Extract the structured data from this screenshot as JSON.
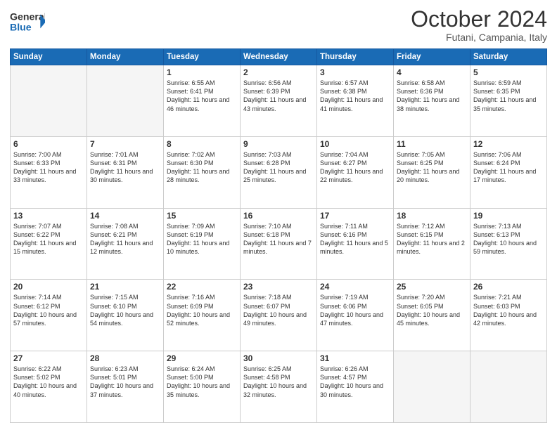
{
  "header": {
    "logo_line1": "General",
    "logo_line2": "Blue",
    "month": "October 2024",
    "location": "Futani, Campania, Italy"
  },
  "days_of_week": [
    "Sunday",
    "Monday",
    "Tuesday",
    "Wednesday",
    "Thursday",
    "Friday",
    "Saturday"
  ],
  "weeks": [
    [
      {
        "day": "",
        "sunrise": "",
        "sunset": "",
        "daylight": "",
        "empty": true
      },
      {
        "day": "",
        "sunrise": "",
        "sunset": "",
        "daylight": "",
        "empty": true
      },
      {
        "day": "1",
        "sunrise": "Sunrise: 6:55 AM",
        "sunset": "Sunset: 6:41 PM",
        "daylight": "Daylight: 11 hours and 46 minutes.",
        "empty": false
      },
      {
        "day": "2",
        "sunrise": "Sunrise: 6:56 AM",
        "sunset": "Sunset: 6:39 PM",
        "daylight": "Daylight: 11 hours and 43 minutes.",
        "empty": false
      },
      {
        "day": "3",
        "sunrise": "Sunrise: 6:57 AM",
        "sunset": "Sunset: 6:38 PM",
        "daylight": "Daylight: 11 hours and 41 minutes.",
        "empty": false
      },
      {
        "day": "4",
        "sunrise": "Sunrise: 6:58 AM",
        "sunset": "Sunset: 6:36 PM",
        "daylight": "Daylight: 11 hours and 38 minutes.",
        "empty": false
      },
      {
        "day": "5",
        "sunrise": "Sunrise: 6:59 AM",
        "sunset": "Sunset: 6:35 PM",
        "daylight": "Daylight: 11 hours and 35 minutes.",
        "empty": false
      }
    ],
    [
      {
        "day": "6",
        "sunrise": "Sunrise: 7:00 AM",
        "sunset": "Sunset: 6:33 PM",
        "daylight": "Daylight: 11 hours and 33 minutes.",
        "empty": false
      },
      {
        "day": "7",
        "sunrise": "Sunrise: 7:01 AM",
        "sunset": "Sunset: 6:31 PM",
        "daylight": "Daylight: 11 hours and 30 minutes.",
        "empty": false
      },
      {
        "day": "8",
        "sunrise": "Sunrise: 7:02 AM",
        "sunset": "Sunset: 6:30 PM",
        "daylight": "Daylight: 11 hours and 28 minutes.",
        "empty": false
      },
      {
        "day": "9",
        "sunrise": "Sunrise: 7:03 AM",
        "sunset": "Sunset: 6:28 PM",
        "daylight": "Daylight: 11 hours and 25 minutes.",
        "empty": false
      },
      {
        "day": "10",
        "sunrise": "Sunrise: 7:04 AM",
        "sunset": "Sunset: 6:27 PM",
        "daylight": "Daylight: 11 hours and 22 minutes.",
        "empty": false
      },
      {
        "day": "11",
        "sunrise": "Sunrise: 7:05 AM",
        "sunset": "Sunset: 6:25 PM",
        "daylight": "Daylight: 11 hours and 20 minutes.",
        "empty": false
      },
      {
        "day": "12",
        "sunrise": "Sunrise: 7:06 AM",
        "sunset": "Sunset: 6:24 PM",
        "daylight": "Daylight: 11 hours and 17 minutes.",
        "empty": false
      }
    ],
    [
      {
        "day": "13",
        "sunrise": "Sunrise: 7:07 AM",
        "sunset": "Sunset: 6:22 PM",
        "daylight": "Daylight: 11 hours and 15 minutes.",
        "empty": false
      },
      {
        "day": "14",
        "sunrise": "Sunrise: 7:08 AM",
        "sunset": "Sunset: 6:21 PM",
        "daylight": "Daylight: 11 hours and 12 minutes.",
        "empty": false
      },
      {
        "day": "15",
        "sunrise": "Sunrise: 7:09 AM",
        "sunset": "Sunset: 6:19 PM",
        "daylight": "Daylight: 11 hours and 10 minutes.",
        "empty": false
      },
      {
        "day": "16",
        "sunrise": "Sunrise: 7:10 AM",
        "sunset": "Sunset: 6:18 PM",
        "daylight": "Daylight: 11 hours and 7 minutes.",
        "empty": false
      },
      {
        "day": "17",
        "sunrise": "Sunrise: 7:11 AM",
        "sunset": "Sunset: 6:16 PM",
        "daylight": "Daylight: 11 hours and 5 minutes.",
        "empty": false
      },
      {
        "day": "18",
        "sunrise": "Sunrise: 7:12 AM",
        "sunset": "Sunset: 6:15 PM",
        "daylight": "Daylight: 11 hours and 2 minutes.",
        "empty": false
      },
      {
        "day": "19",
        "sunrise": "Sunrise: 7:13 AM",
        "sunset": "Sunset: 6:13 PM",
        "daylight": "Daylight: 10 hours and 59 minutes.",
        "empty": false
      }
    ],
    [
      {
        "day": "20",
        "sunrise": "Sunrise: 7:14 AM",
        "sunset": "Sunset: 6:12 PM",
        "daylight": "Daylight: 10 hours and 57 minutes.",
        "empty": false
      },
      {
        "day": "21",
        "sunrise": "Sunrise: 7:15 AM",
        "sunset": "Sunset: 6:10 PM",
        "daylight": "Daylight: 10 hours and 54 minutes.",
        "empty": false
      },
      {
        "day": "22",
        "sunrise": "Sunrise: 7:16 AM",
        "sunset": "Sunset: 6:09 PM",
        "daylight": "Daylight: 10 hours and 52 minutes.",
        "empty": false
      },
      {
        "day": "23",
        "sunrise": "Sunrise: 7:18 AM",
        "sunset": "Sunset: 6:07 PM",
        "daylight": "Daylight: 10 hours and 49 minutes.",
        "empty": false
      },
      {
        "day": "24",
        "sunrise": "Sunrise: 7:19 AM",
        "sunset": "Sunset: 6:06 PM",
        "daylight": "Daylight: 10 hours and 47 minutes.",
        "empty": false
      },
      {
        "day": "25",
        "sunrise": "Sunrise: 7:20 AM",
        "sunset": "Sunset: 6:05 PM",
        "daylight": "Daylight: 10 hours and 45 minutes.",
        "empty": false
      },
      {
        "day": "26",
        "sunrise": "Sunrise: 7:21 AM",
        "sunset": "Sunset: 6:03 PM",
        "daylight": "Daylight: 10 hours and 42 minutes.",
        "empty": false
      }
    ],
    [
      {
        "day": "27",
        "sunrise": "Sunrise: 6:22 AM",
        "sunset": "Sunset: 5:02 PM",
        "daylight": "Daylight: 10 hours and 40 minutes.",
        "empty": false
      },
      {
        "day": "28",
        "sunrise": "Sunrise: 6:23 AM",
        "sunset": "Sunset: 5:01 PM",
        "daylight": "Daylight: 10 hours and 37 minutes.",
        "empty": false
      },
      {
        "day": "29",
        "sunrise": "Sunrise: 6:24 AM",
        "sunset": "Sunset: 5:00 PM",
        "daylight": "Daylight: 10 hours and 35 minutes.",
        "empty": false
      },
      {
        "day": "30",
        "sunrise": "Sunrise: 6:25 AM",
        "sunset": "Sunset: 4:58 PM",
        "daylight": "Daylight: 10 hours and 32 minutes.",
        "empty": false
      },
      {
        "day": "31",
        "sunrise": "Sunrise: 6:26 AM",
        "sunset": "Sunset: 4:57 PM",
        "daylight": "Daylight: 10 hours and 30 minutes.",
        "empty": false
      },
      {
        "day": "",
        "sunrise": "",
        "sunset": "",
        "daylight": "",
        "empty": true
      },
      {
        "day": "",
        "sunrise": "",
        "sunset": "",
        "daylight": "",
        "empty": true
      }
    ]
  ]
}
